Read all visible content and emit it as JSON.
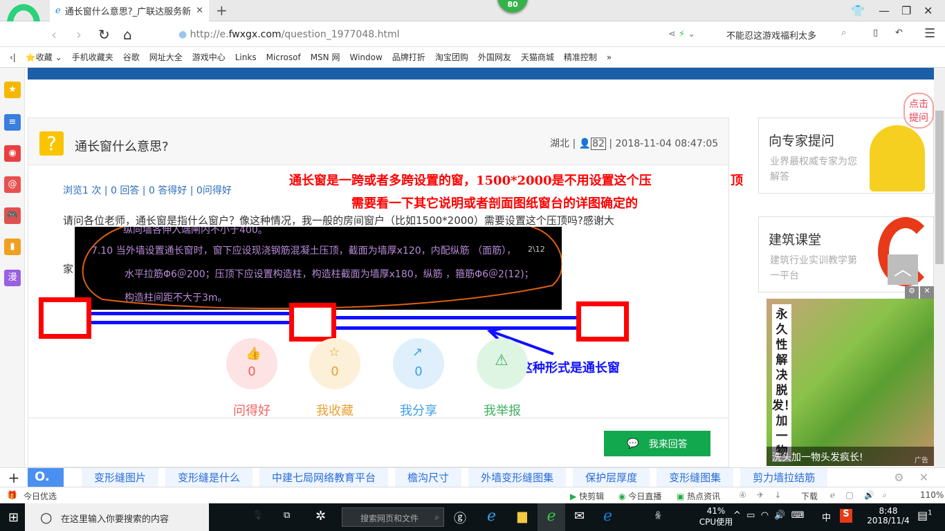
{
  "browser": {
    "tab_title": "通长窗什么意思?_广联达服务新",
    "badge": "80",
    "url_prefix": "http://e.",
    "url_domain": "fwxgx.com",
    "url_path": "/question_1977048.html",
    "hot_search": "不能忍这游戏福利太多",
    "zoom": "110%"
  },
  "bookmarks": [
    "收藏",
    "手机收藏夹",
    "谷歌",
    "网址大全",
    "游戏中心",
    "Links",
    "Microsof",
    "MSN 网",
    "Window",
    "品牌打折",
    "淘宝团购",
    "外国网友",
    "天猫商城",
    "精准控制"
  ],
  "question": {
    "title": "通长窗什么意思?",
    "region": "湖北",
    "user_id": "82",
    "datetime": "2018-11-04 08:47:05",
    "stats": "浏览1 次 | 0 回答 | 0 答得好 | 0问得好",
    "body_line1": "请问各位老师，通长窗是指什么窗户？像这种情况，我一般的房间窗户（比如1500*2000）需要设置这个压顶吗?感谢大",
    "body_line2": "家"
  },
  "annotations": {
    "red_line1": "通长窗是一跨或者多跨设置的窗，1500*2000是不用设置这个压",
    "red_line1_tail": "顶",
    "red_line2": "需要看一下其它说明或者剖面图纸窗台的详图确定的",
    "blue_label": "这种形式是通长窗"
  },
  "cad_text": {
    "line0": "纵向墙各伸入端闸内不小于400。",
    "line1": "7.10   当外墙设置通长窗时，窗下应设现浇钢筋混凝土压顶，截面为墙厚x120，内配纵筋      （面筋），",
    "line1_tag": "2\\12",
    "line2": "水平拉筋Φ6＠200；压顶下应设置构造柱，构造柱截面为墙厚x180，纵筋        ，箍筋Φ6＠2(12)；",
    "line3": "构造柱间距不大于3m。"
  },
  "actions": [
    {
      "label": "问得好",
      "count": "0",
      "color": "#f06060",
      "bg": "#fde3e3"
    },
    {
      "label": "我收藏",
      "count": "0",
      "color": "#e8a030",
      "bg": "#fdf0d8"
    },
    {
      "label": "我分享",
      "count": "0",
      "color": "#3a9ee8",
      "bg": "#dff0fc"
    },
    {
      "label": "我举报",
      "count": "0",
      "color": "#40b060",
      "bg": "#dff5e4"
    }
  ],
  "answer_button": "我来回答",
  "sidebar": {
    "expert_title": "向专家提问",
    "expert_desc": "业界最权威专家为您解答",
    "bubble": "点击提问",
    "course_title": "建筑课堂",
    "course_desc": "建筑行业实训教学第一平台"
  },
  "ad": {
    "vertical": "永久性解决脱发！加一物",
    "caption": "洗头加一物头发疯长!",
    "tag": "广告"
  },
  "suggestions": [
    "变形缝图片",
    "变形缝是什么",
    "中建七局网络教育平台",
    "檐沟尺寸",
    "外墙变形缝图集",
    "保护层厚度",
    "变形缝图集",
    "剪力墙拉结筋"
  ],
  "statusbar": {
    "left": "今日优选",
    "items": [
      "快剪辑",
      "今日直播",
      "热点资讯",
      "下载"
    ]
  },
  "taskbar": {
    "search_placeholder": "在这里输入你要搜索的内容",
    "web_search": "搜索网页和文件",
    "cpu": "41%",
    "cpu_label": "CPU使用",
    "ime": "中",
    "time": "8:48",
    "date": "2018/11/4",
    "notif": "1"
  }
}
